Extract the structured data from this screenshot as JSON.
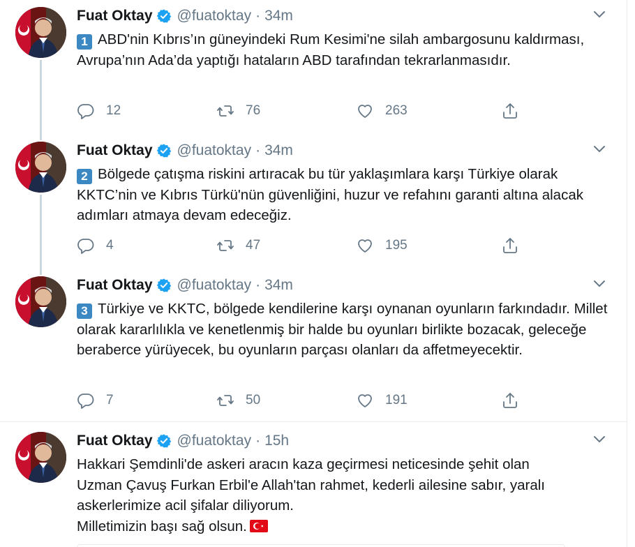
{
  "tweets": [
    {
      "name": "Fuat Oktay",
      "handle": "@fuatoktay",
      "time": "34m",
      "number": "1",
      "text": "ABD'nin Kıbrıs’ın güneyindeki Rum Kesimi'ne silah ambargosunu kaldırması, Avrupa’nın Ada’da yaptığı hataların ABD tarafından tekrarlanmasıdır.",
      "replies": "12",
      "retweets": "76",
      "likes": "263"
    },
    {
      "name": "Fuat Oktay",
      "handle": "@fuatoktay",
      "time": "34m",
      "number": "2",
      "text": "Bölgede çatışma riskini artıracak bu tür yaklaşımlara karşı Türkiye olarak KKTC’nin ve Kıbrıs Türkü'nün güvenliğini, huzur ve refahını garanti altına alacak adımları atmaya devam edeceğiz.",
      "replies": "4",
      "retweets": "47",
      "likes": "195"
    },
    {
      "name": "Fuat Oktay",
      "handle": "@fuatoktay",
      "time": "34m",
      "number": "3",
      "text": "Türkiye ve KKTC, bölgede kendilerine karşı oynanan oyunların farkındadır. Millet olarak kararlılıkla ve kenetlenmiş bir halde bu oyunları birlikte bozacak, geleceğe beraberce yürüyecek, bu oyunların parçası olanları da affetmeyecektir.",
      "replies": "7",
      "retweets": "50",
      "likes": "191"
    },
    {
      "name": "Fuat Oktay",
      "handle": "@fuatoktay",
      "time": "15h",
      "line1": "Hakkari Şemdinli'de askeri aracın kaza geçirmesi neticesinde şehit olan",
      "line2": "Uzman Çavuş Furkan Erbil'e Allah'tan rahmet, kederli ailesine sabır, yaralı",
      "line3": "askerlerimize acil şifalar diliyorum.",
      "line4": "Milletimizin başı sağ olsun."
    }
  ],
  "icons": {
    "verified": "verified-badge-icon",
    "caret": "chevron-down-icon",
    "reply": "reply-icon",
    "retweet": "retweet-icon",
    "like": "heart-icon",
    "share": "share-icon",
    "flag": "turkey-flag-emoji"
  },
  "colors": {
    "verified": "#1da1f2",
    "keycap": "#3b88c3",
    "muted": "#657786",
    "threadLine": "#ccd6dd",
    "divider": "#e6ecf0"
  }
}
